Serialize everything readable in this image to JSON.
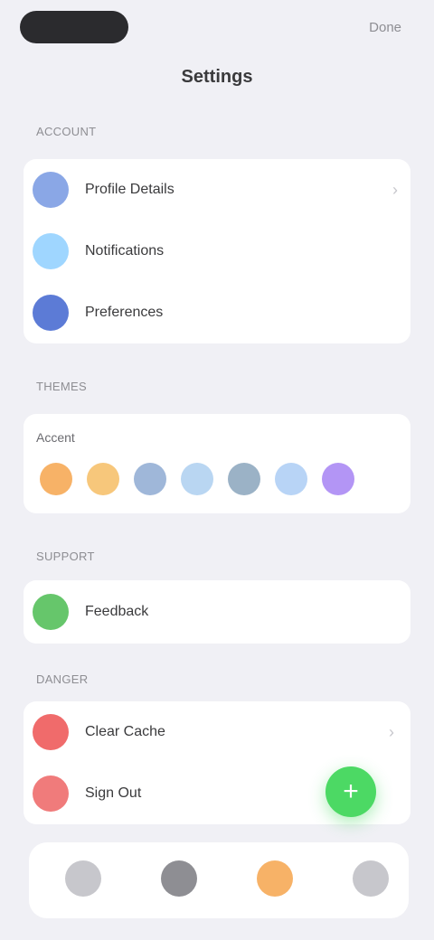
{
  "status": {
    "top_action": "Done"
  },
  "header": {
    "title": "Settings"
  },
  "sections": {
    "account": {
      "label": "Account",
      "rows": [
        {
          "label": "Profile Details",
          "icon": "user-icon",
          "color": "#8aa7e6"
        },
        {
          "label": "Notifications",
          "icon": "bell-icon",
          "color": "#9fd6ff"
        },
        {
          "label": "Preferences",
          "icon": "gear-icon",
          "color": "#5c7bd6"
        }
      ]
    },
    "themes": {
      "label": "Themes",
      "subtitle": "Accent",
      "colors": [
        "#f7b267",
        "#f7c77b",
        "#9fb7d9",
        "#b9d6f2",
        "#9bb2c6",
        "#b8d4f6",
        "#b395f5"
      ]
    },
    "support": {
      "label": "Support",
      "row": {
        "label": "Feedback",
        "icon": "star-icon",
        "color": "#66c66b"
      }
    },
    "danger": {
      "label": "Danger",
      "rows": [
        {
          "label": "Clear Cache",
          "icon": "trash-icon",
          "color": "#f06b6b"
        },
        {
          "label": "Sign Out",
          "icon": "logout-icon",
          "color": "#f07b7b"
        }
      ]
    }
  },
  "tabbar": {
    "tabs": [
      {
        "name": "home",
        "icon": "home-icon",
        "color": "#c7c7cc"
      },
      {
        "name": "profile",
        "icon": "profile-icon",
        "color": "#8e8e93"
      },
      {
        "name": "favorites",
        "icon": "heart-icon",
        "color": "#f7b267"
      },
      {
        "name": "settings",
        "icon": "settings-icon",
        "color": "#c7c7cc"
      }
    ]
  }
}
